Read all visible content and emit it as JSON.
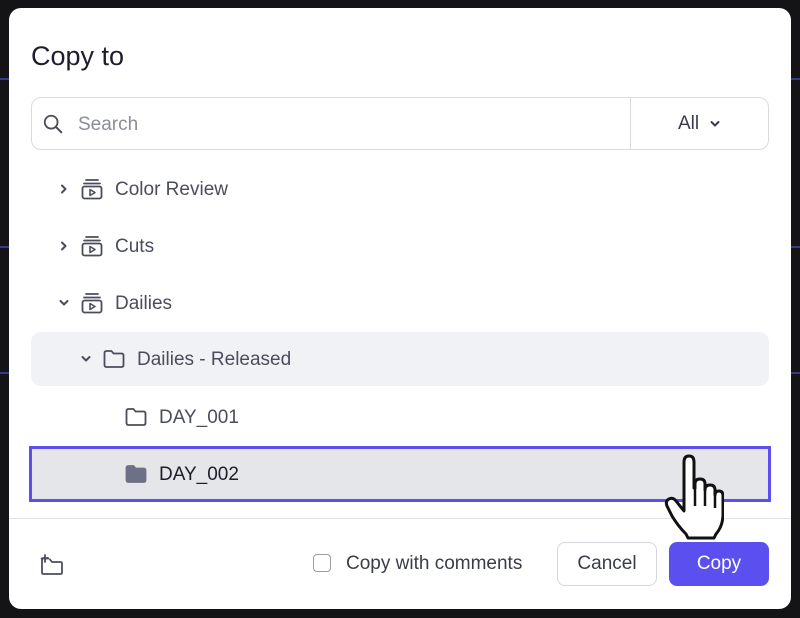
{
  "dialog": {
    "title": "Copy to"
  },
  "search": {
    "placeholder": "Search",
    "value": "",
    "filter": "All"
  },
  "tree": {
    "items": [
      {
        "label": "Color Review",
        "kind": "reel",
        "expanded": false,
        "level": 0
      },
      {
        "label": "Cuts",
        "kind": "reel",
        "expanded": false,
        "level": 0
      },
      {
        "label": "Dailies",
        "kind": "reel",
        "expanded": true,
        "level": 0
      },
      {
        "label": "Dailies - Released",
        "kind": "folder",
        "expanded": true,
        "level": 1
      },
      {
        "label": "DAY_001",
        "kind": "folder",
        "expanded": false,
        "level": 2
      },
      {
        "label": "DAY_002",
        "kind": "folder-filled",
        "expanded": false,
        "level": 2,
        "selected": true
      }
    ]
  },
  "footer": {
    "copy_with_comments_label": "Copy with comments",
    "copy_with_comments_checked": false,
    "cancel_label": "Cancel",
    "copy_label": "Copy"
  },
  "colors": {
    "accent": "#5b4ff0",
    "selected_row": "#e5e6ea",
    "hover_row": "#f1f2f5"
  },
  "icons": {
    "search": "search-icon",
    "filter_chevron": "chevron-down-icon",
    "expand_collapsed": "chevron-right-icon",
    "expand_open": "chevron-down-icon",
    "reel": "media-stack-icon",
    "folder": "folder-icon",
    "folder_filled": "folder-filled-icon",
    "new_folder": "new-folder-icon",
    "cursor": "hand-pointer-icon"
  }
}
